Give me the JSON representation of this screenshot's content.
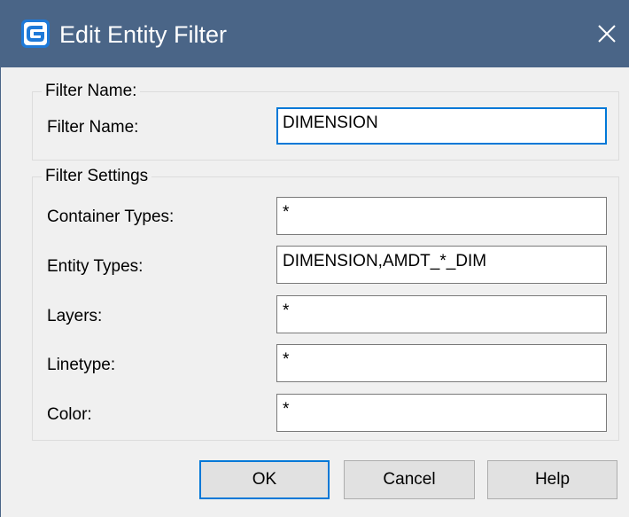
{
  "window": {
    "title": "Edit Entity Filter",
    "icon": "app-logo-icon",
    "close_icon": "close-icon"
  },
  "filter_name_group": {
    "title": "Filter Name:",
    "label": "Filter Name:",
    "value": "DIMENSION"
  },
  "filter_settings_group": {
    "title": "Filter Settings",
    "fields": [
      {
        "label": "Container Types:",
        "value": "*"
      },
      {
        "label": "Entity Types:",
        "value": "DIMENSION,AMDT_*_DIM"
      },
      {
        "label": "Layers:",
        "value": "*"
      },
      {
        "label": "Linetype:",
        "value": "*"
      },
      {
        "label": "Color:",
        "value": "*"
      }
    ]
  },
  "buttons": {
    "ok": "OK",
    "cancel": "Cancel",
    "help": "Help"
  },
  "colors": {
    "titlebar": "#4a6587",
    "dialog_bg": "#f0f0f0",
    "focus_accent": "#0078d7",
    "logo_blue": "#1e7ad9"
  }
}
